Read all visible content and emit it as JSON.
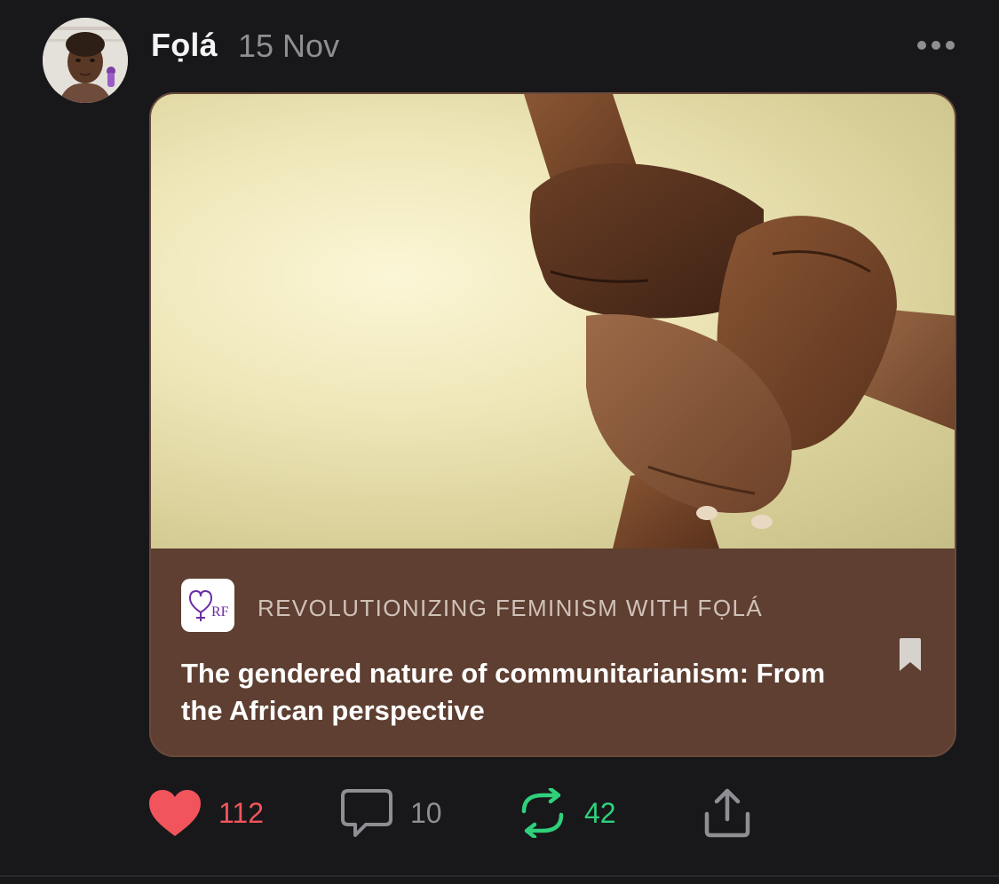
{
  "post": {
    "author": "Fọlá",
    "date": "15 Nov",
    "avatar_icon": "profile-photo",
    "more_icon": "ellipsis-icon"
  },
  "card": {
    "image_description_icon": "joined-hands-photo",
    "publication": {
      "name": "REVOLUTIONIZING FEMINISM WITH FỌLÁ",
      "logo_monogram": "RF"
    },
    "title": "The gendered nature of communitarianism: From the African perspective",
    "bookmark_icon": "bookmark-icon"
  },
  "actions": {
    "likes": "112",
    "comments": "10",
    "restacks": "42",
    "like_color": "#f2545b",
    "restack_color": "#2fd17b"
  },
  "colors": {
    "background": "#18181b",
    "card": "#5e3f31",
    "logo_accent": "#6b2ea3"
  }
}
